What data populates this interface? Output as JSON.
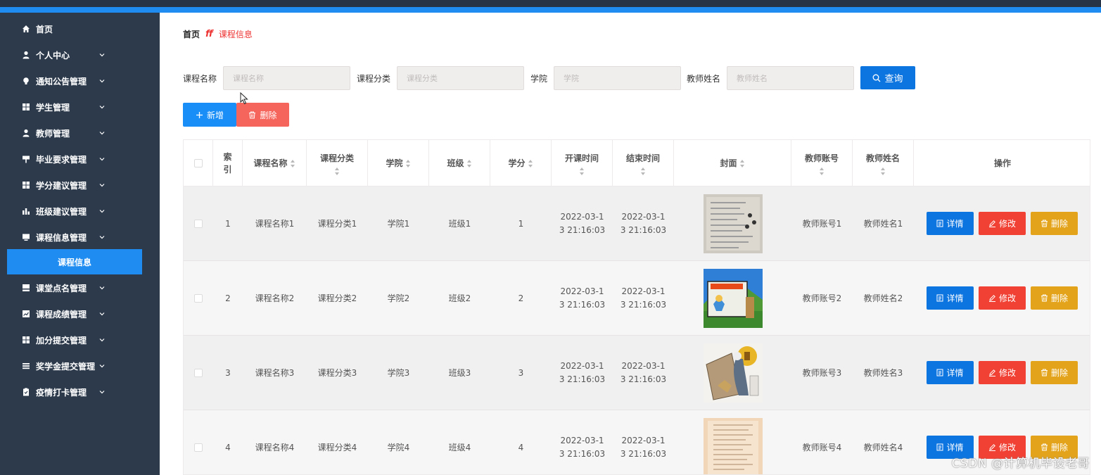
{
  "sidebar": {
    "items": [
      {
        "label": "首页",
        "icon": "home-icon",
        "expandable": false
      },
      {
        "label": "个人中心",
        "icon": "user-icon",
        "expandable": true
      },
      {
        "label": "通知公告管理",
        "icon": "bulb-icon",
        "expandable": true
      },
      {
        "label": "学生管理",
        "icon": "grid-icon",
        "expandable": true
      },
      {
        "label": "教师管理",
        "icon": "user-icon",
        "expandable": true
      },
      {
        "label": "毕业要求管理",
        "icon": "sign-icon",
        "expandable": true
      },
      {
        "label": "学分建议管理",
        "icon": "grid-icon",
        "expandable": true
      },
      {
        "label": "班级建议管理",
        "icon": "bar-chart-icon",
        "expandable": true
      },
      {
        "label": "课程信息管理",
        "icon": "monitor-icon",
        "expandable": true
      },
      {
        "label": "课堂点名管理",
        "icon": "person-board-icon",
        "expandable": true
      },
      {
        "label": "课程成绩管理",
        "icon": "chart-icon",
        "expandable": true
      },
      {
        "label": "加分提交管理",
        "icon": "grid-icon",
        "expandable": true
      },
      {
        "label": "奖学金提交管理",
        "icon": "list-icon",
        "expandable": true
      },
      {
        "label": "疫情打卡管理",
        "icon": "clipboard-icon",
        "expandable": true
      }
    ],
    "active_subitem": "课程信息"
  },
  "breadcrumb": {
    "home": "首页",
    "current": "课程信息"
  },
  "search": {
    "fields": [
      {
        "label": "课程名称",
        "placeholder": "课程名称"
      },
      {
        "label": "课程分类",
        "placeholder": "课程分类"
      },
      {
        "label": "学院",
        "placeholder": "学院"
      },
      {
        "label": "教师姓名",
        "placeholder": "教师姓名"
      }
    ],
    "query_label": "查询"
  },
  "toolbar": {
    "add_label": "新增",
    "delete_label": "删除"
  },
  "table": {
    "headers": {
      "index_line1": "索",
      "index_line2": "引",
      "course_name": "课程名称",
      "category": "课程分类",
      "college": "学院",
      "class": "班级",
      "credit": "学分",
      "start_time": "开课时间",
      "end_time": "结束时间",
      "cover": "封面",
      "teacher_account": "教师账号",
      "teacher_name": "教师姓名",
      "actions": "操作"
    },
    "rows": [
      {
        "index": "1",
        "course_name": "课程名称1",
        "category": "课程分类1",
        "college": "学院1",
        "class": "班级1",
        "credit": "1",
        "start_l1": "2022-03-1",
        "start_l2": "3 21:16:03",
        "end_l1": "2022-03-1",
        "end_l2": "3 21:16:03",
        "teacher_account": "教师账号1",
        "teacher_name": "教师姓名1"
      },
      {
        "index": "2",
        "course_name": "课程名称2",
        "category": "课程分类2",
        "college": "学院2",
        "class": "班级2",
        "credit": "2",
        "start_l1": "2022-03-1",
        "start_l2": "3 21:16:03",
        "end_l1": "2022-03-1",
        "end_l2": "3 21:16:03",
        "teacher_account": "教师账号2",
        "teacher_name": "教师姓名2"
      },
      {
        "index": "3",
        "course_name": "课程名称3",
        "category": "课程分类3",
        "college": "学院3",
        "class": "班级3",
        "credit": "3",
        "start_l1": "2022-03-1",
        "start_l2": "3 21:16:03",
        "end_l1": "2022-03-1",
        "end_l2": "3 21:16:03",
        "teacher_account": "教师账号3",
        "teacher_name": "教师姓名3"
      },
      {
        "index": "4",
        "course_name": "课程名称4",
        "category": "课程分类4",
        "college": "学院4",
        "class": "班级4",
        "credit": "4",
        "start_l1": "2022-03-1",
        "start_l2": "3 21:16:03",
        "end_l1": "2022-03-1",
        "end_l2": "3 21:16:03",
        "teacher_account": "教师账号4",
        "teacher_name": "教师姓名4"
      }
    ],
    "row_actions": {
      "detail": "详情",
      "edit": "修改",
      "delete": "删除"
    }
  },
  "watermark": "CSDN @计算机毕设老哥",
  "colors": {
    "sidebar": "#2c3a4c",
    "accent": "#1e8cf0",
    "primary": "#0d75e0",
    "danger": "#f04134",
    "warning": "#e3a41c"
  }
}
